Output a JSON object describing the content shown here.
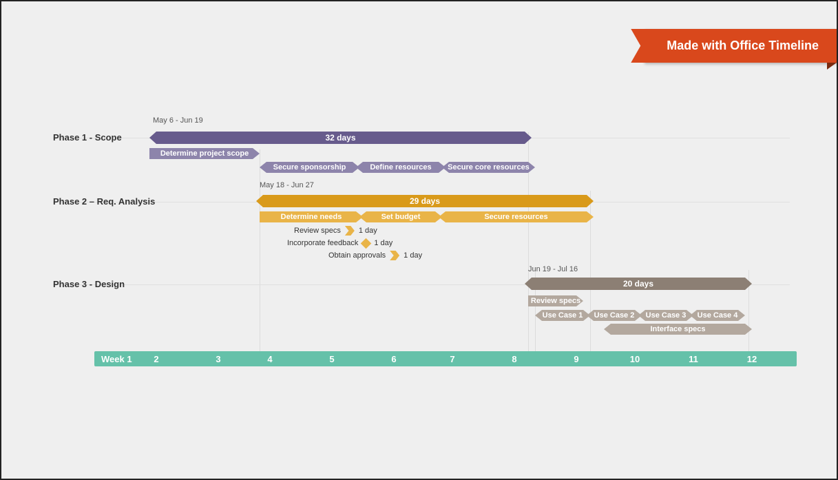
{
  "banner": "Made with Office Timeline",
  "axis_start": "Week 1",
  "weeks": [
    "2",
    "3",
    "4",
    "5",
    "6",
    "7",
    "8",
    "9",
    "10",
    "11",
    "12"
  ],
  "phase1_label": "Phase 1 - Scope",
  "phase1_range": "May 6 - Jun 19",
  "phase1_summary": "32 days",
  "p1_t1": "Determine project scope",
  "p1_t2": "Secure sponsorship",
  "p1_t3": "Define resources",
  "p1_t4": "Secure core resources",
  "phase2_label": "Phase 2 – Req. Analysis",
  "phase2_range": "May 18 - Jun 27",
  "phase2_summary": "29 days",
  "p2_t1": "Determine needs",
  "p2_t2": "Set budget",
  "p2_t3": "Secure resources",
  "p2_m1": "Review specs",
  "p2_m1d": "1 day",
  "p2_m2": "Incorporate feedback",
  "p2_m2d": "1 day",
  "p2_m3": "Obtain approvals",
  "p2_m3d": "1 day",
  "phase3_label": "Phase 3 - Design",
  "phase3_range": "Jun 19 - Jul 16",
  "phase3_summary": "20 days",
  "p3_t1": "Review specs",
  "p3_u1": "Use Case 1",
  "p3_u2": "Use Case 2",
  "p3_u3": "Use Case 3",
  "p3_u4": "Use Case 4",
  "p3_t2": "Interface specs",
  "chart_data": {
    "type": "bar",
    "title": "",
    "xlabel": "Week",
    "ylabel": "",
    "timeline_weeks": [
      1,
      2,
      3,
      4,
      5,
      6,
      7,
      8,
      9,
      10,
      11,
      12
    ],
    "series": [
      {
        "name": "Phase 1 - Scope",
        "date_range": "May 6 - Jun 19",
        "duration_days": 32,
        "start_week": 1,
        "end_week": 8,
        "tasks": [
          {
            "name": "Determine project scope",
            "start_week": 1,
            "end_week": 3
          },
          {
            "name": "Secure sponsorship",
            "start_week": 3,
            "end_week": 4.7
          },
          {
            "name": "Define resources",
            "start_week": 4.7,
            "end_week": 6.2
          },
          {
            "name": "Secure core resources",
            "start_week": 6.2,
            "end_week": 8
          }
        ]
      },
      {
        "name": "Phase 2 – Req. Analysis",
        "date_range": "May 18 - Jun 27",
        "duration_days": 29,
        "start_week": 3,
        "end_week": 9,
        "tasks": [
          {
            "name": "Determine needs",
            "start_week": 3,
            "end_week": 4.8
          },
          {
            "name": "Set budget",
            "start_week": 4.8,
            "end_week": 6.3
          },
          {
            "name": "Secure resources",
            "start_week": 6.3,
            "end_week": 9
          }
        ],
        "milestones": [
          {
            "name": "Review specs",
            "at_week": 4.7,
            "duration": "1 day"
          },
          {
            "name": "Incorporate feedback",
            "at_week": 4.9,
            "duration": "1 day"
          },
          {
            "name": "Obtain approvals",
            "at_week": 5.4,
            "duration": "1 day"
          }
        ]
      },
      {
        "name": "Phase 3 - Design",
        "date_range": "Jun 19 - Jul 16",
        "duration_days": 20,
        "start_week": 8,
        "end_week": 12,
        "tasks": [
          {
            "name": "Review specs",
            "start_week": 8,
            "end_week": 8.7
          },
          {
            "name": "Use Case 1",
            "start_week": 8.1,
            "end_week": 9
          },
          {
            "name": "Use Case 2",
            "start_week": 9,
            "end_week": 9.9
          },
          {
            "name": "Use Case 3",
            "start_week": 9.9,
            "end_week": 10.8
          },
          {
            "name": "Use Case 4",
            "start_week": 10.8,
            "end_week": 11.7
          },
          {
            "name": "Interface specs",
            "start_week": 9.3,
            "end_week": 12
          }
        ]
      }
    ]
  }
}
